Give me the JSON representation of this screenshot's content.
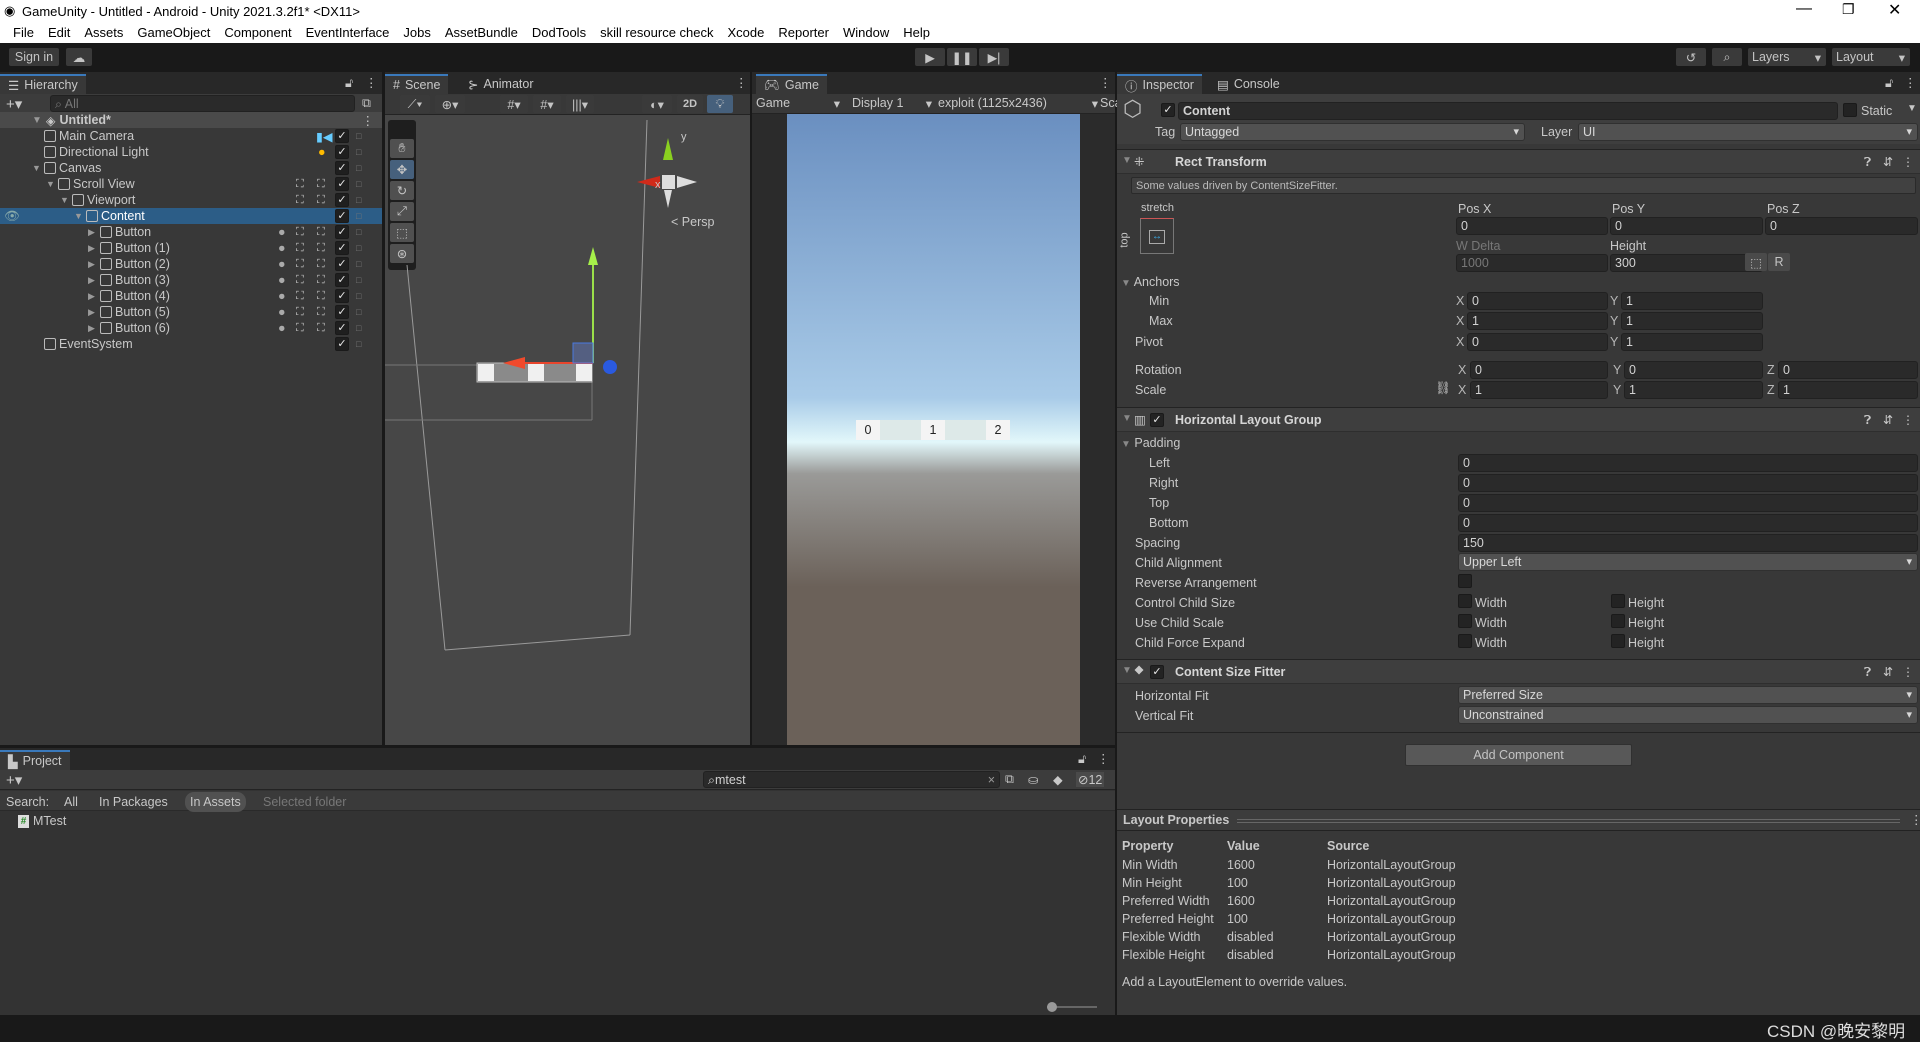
{
  "window": {
    "title": "GameUnity - Untitled - Android - Unity 2021.3.2f1* <DX11>"
  },
  "menu": [
    "File",
    "Edit",
    "Assets",
    "GameObject",
    "Component",
    "EventInterface",
    "Jobs",
    "AssetBundle",
    "DodTools",
    "skill resource check",
    "Xcode",
    "Reporter",
    "Window",
    "Help"
  ],
  "toolbar": {
    "sign_in": "Sign in",
    "layers": "Layers",
    "layout": "Layout"
  },
  "hierarchy": {
    "tab": "Hierarchy",
    "search_placeholder": "All",
    "scene": "Untitled*",
    "items": [
      {
        "label": "Main Camera",
        "depth": 1,
        "expand": "none",
        "badge": "camera"
      },
      {
        "label": "Directional Light",
        "depth": 1,
        "expand": "none",
        "badge": "light"
      },
      {
        "label": "Canvas",
        "depth": 1,
        "expand": "open",
        "badge": ""
      },
      {
        "label": "Scroll View",
        "depth": 2,
        "expand": "open",
        "badge": "ui"
      },
      {
        "label": "Viewport",
        "depth": 3,
        "expand": "open",
        "badge": "ui"
      },
      {
        "label": "Content",
        "depth": 4,
        "expand": "open",
        "badge": "",
        "selected": true
      },
      {
        "label": "Button",
        "depth": 5,
        "expand": "closed",
        "badge": "button"
      },
      {
        "label": "Button (1)",
        "depth": 5,
        "expand": "closed",
        "badge": "button"
      },
      {
        "label": "Button (2)",
        "depth": 5,
        "expand": "closed",
        "badge": "button"
      },
      {
        "label": "Button (3)",
        "depth": 5,
        "expand": "closed",
        "badge": "button"
      },
      {
        "label": "Button (4)",
        "depth": 5,
        "expand": "closed",
        "badge": "button"
      },
      {
        "label": "Button (5)",
        "depth": 5,
        "expand": "closed",
        "badge": "button"
      },
      {
        "label": "Button (6)",
        "depth": 5,
        "expand": "closed",
        "badge": "button"
      },
      {
        "label": "EventSystem",
        "depth": 1,
        "expand": "none",
        "badge": ""
      }
    ]
  },
  "scene": {
    "tab": "Scene",
    "animator_tab": "Animator",
    "btn_2d": "2D",
    "persp": "Persp",
    "axis_y": "y",
    "axis_x": "x"
  },
  "game": {
    "tab": "Game",
    "mode": "Game",
    "display": "Display 1",
    "resolution": "exploit (1125x2436)",
    "scale": "Sca",
    "buttons": [
      "0",
      "1",
      "2"
    ],
    "sky": "#6a8fc0",
    "ground": "#6b6159"
  },
  "inspector": {
    "tab": "Inspector",
    "console_tab": "Console",
    "name": "Content",
    "static": "Static",
    "tag_label": "Tag",
    "tag": "Untagged",
    "layer_label": "Layer",
    "layer": "UI",
    "rect": {
      "title": "Rect Transform",
      "note": "Some values driven by ContentSizeFitter.",
      "anchor_preset": "stretch",
      "anchor_side": "top",
      "pos_x_label": "Pos X",
      "pos_y_label": "Pos Y",
      "pos_z_label": "Pos Z",
      "pos_x": "0",
      "pos_y": "0",
      "pos_z": "0",
      "w_label": "W Delta",
      "h_label": "Height",
      "w": "1000",
      "h": "300",
      "r_btn": "R",
      "anchors": "Anchors",
      "min": "Min",
      "max": "Max",
      "min_x": "0",
      "min_y": "1",
      "max_x": "1",
      "max_y": "1",
      "pivot": "Pivot",
      "pivot_x": "0",
      "pivot_y": "1",
      "rotation": "Rotation",
      "rot_x": "0",
      "rot_y": "0",
      "rot_z": "0",
      "scale": "Scale",
      "scale_x": "1",
      "scale_y": "1",
      "scale_z": "1"
    },
    "hlg": {
      "title": "Horizontal Layout Group",
      "padding": "Padding",
      "left": "Left",
      "right": "Right",
      "top": "Top",
      "bottom": "Bottom",
      "left_v": "0",
      "right_v": "0",
      "top_v": "0",
      "bottom_v": "0",
      "spacing": "Spacing",
      "spacing_v": "150",
      "child_alignment": "Child Alignment",
      "child_alignment_v": "Upper Left",
      "reverse": "Reverse Arrangement",
      "control": "Control Child Size",
      "use_scale": "Use Child Scale",
      "force_expand": "Child Force Expand",
      "width": "Width",
      "height": "Height"
    },
    "csf": {
      "title": "Content Size Fitter",
      "hfit": "Horizontal Fit",
      "hfit_v": "Preferred Size",
      "vfit": "Vertical Fit",
      "vfit_v": "Unconstrained"
    },
    "add_component": "Add Component",
    "layout_props": {
      "title": "Layout Properties",
      "headers": [
        "Property",
        "Value",
        "Source"
      ],
      "rows": [
        [
          "Min Width",
          "1600",
          "HorizontalLayoutGroup"
        ],
        [
          "Min Height",
          "100",
          "HorizontalLayoutGroup"
        ],
        [
          "Preferred Width",
          "1600",
          "HorizontalLayoutGroup"
        ],
        [
          "Preferred Height",
          "100",
          "HorizontalLayoutGroup"
        ],
        [
          "Flexible Width",
          "disabled",
          "HorizontalLayoutGroup"
        ],
        [
          "Flexible Height",
          "disabled",
          "HorizontalLayoutGroup"
        ]
      ],
      "note": "Add a LayoutElement to override values."
    }
  },
  "project": {
    "tab": "Project",
    "search": "mtest",
    "hidden_count": "12",
    "search_label": "Search:",
    "filters": [
      "All",
      "In Packages",
      "In Assets",
      "Selected folder"
    ],
    "items": [
      "MTest"
    ]
  },
  "watermark": "CSDN @晚安黎明"
}
